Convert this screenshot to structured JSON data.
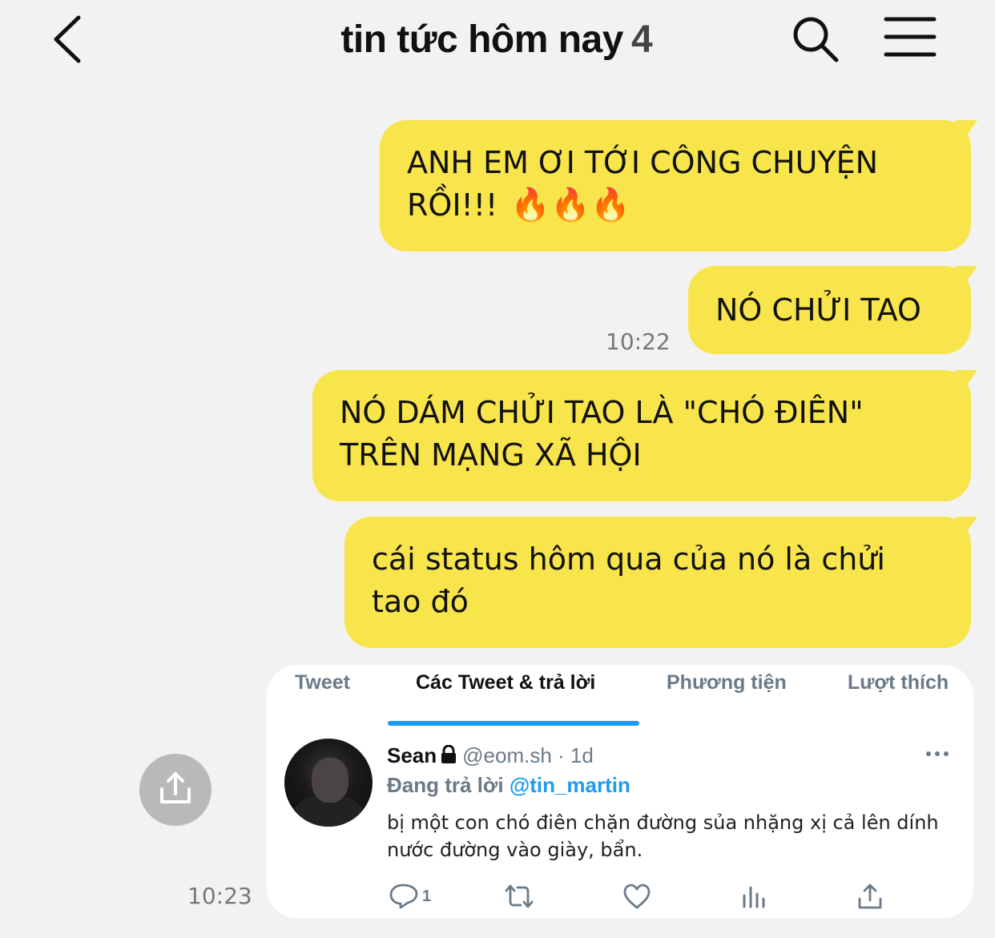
{
  "header": {
    "title": "tin tức hôm nay",
    "member_count": "4",
    "icons": {
      "back": "chevron-left-icon",
      "search": "search-icon",
      "menu": "hamburger-menu-icon"
    }
  },
  "messages": [
    {
      "lines": [
        "ANH EM ƠI TỚI CÔNG CHUYỆN",
        "RỒI!!!"
      ],
      "emoji": "🔥🔥🔥"
    },
    {
      "lines": [
        "NÓ CHỬI TAO"
      ],
      "time": "10:22"
    },
    {
      "lines": [
        "NÓ DÁM CHỬI TAO LÀ \"CHÓ ĐIÊN\"",
        "TRÊN MẠNG XÃ HỘI"
      ]
    },
    {
      "lines": [
        "cái status hôm qua của nó là chửi",
        "tao đó"
      ]
    }
  ],
  "image_message": {
    "time": "10:23",
    "tabs": [
      "Tweet",
      "Các Tweet & trả lời",
      "Phương tiện",
      "Lượt thích"
    ],
    "active_tab": "Các Tweet & trả lời",
    "tweet": {
      "name": "Sean",
      "handle": "@eom.sh · 1d",
      "replying_prefix": "Đang trả lời",
      "replying_to": "@tin_martin",
      "text": "bị một con chó điên chặn đường sủa nhặng xị cả lên dính nước đường vào giày, bẩn.",
      "reply_count": "1"
    }
  },
  "colors": {
    "bubble": "#f8e44b",
    "background": "#f2f2f2",
    "twitter_blue": "#1d9bf0",
    "muted": "#6b7a88"
  }
}
